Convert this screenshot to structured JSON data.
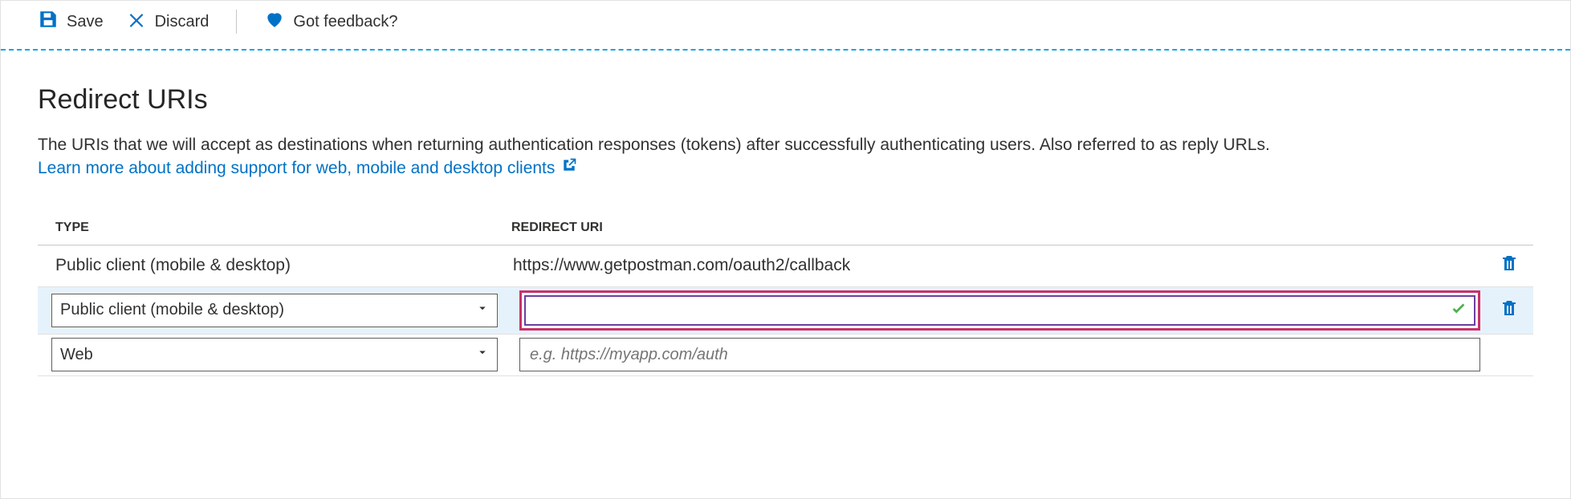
{
  "toolbar": {
    "save_label": "Save",
    "discard_label": "Discard",
    "feedback_label": "Got feedback?"
  },
  "section": {
    "title": "Redirect URIs",
    "description": "The URIs that we will accept as destinations when returning authentication responses (tokens) after successfully authenticating users. Also referred to as reply URLs.",
    "learn_more": "Learn more about adding support for web, mobile and desktop clients"
  },
  "table": {
    "headers": {
      "type": "TYPE",
      "uri": "REDIRECT URI"
    },
    "rows": [
      {
        "type_value": "Public client (mobile & desktop)",
        "uri_value": "https://www.getpostman.com/oauth2/callback"
      },
      {
        "type_value": "Public client (mobile & desktop)",
        "uri_value": ""
      },
      {
        "type_value": "Web",
        "uri_placeholder": "e.g. https://myapp.com/auth"
      }
    ]
  }
}
